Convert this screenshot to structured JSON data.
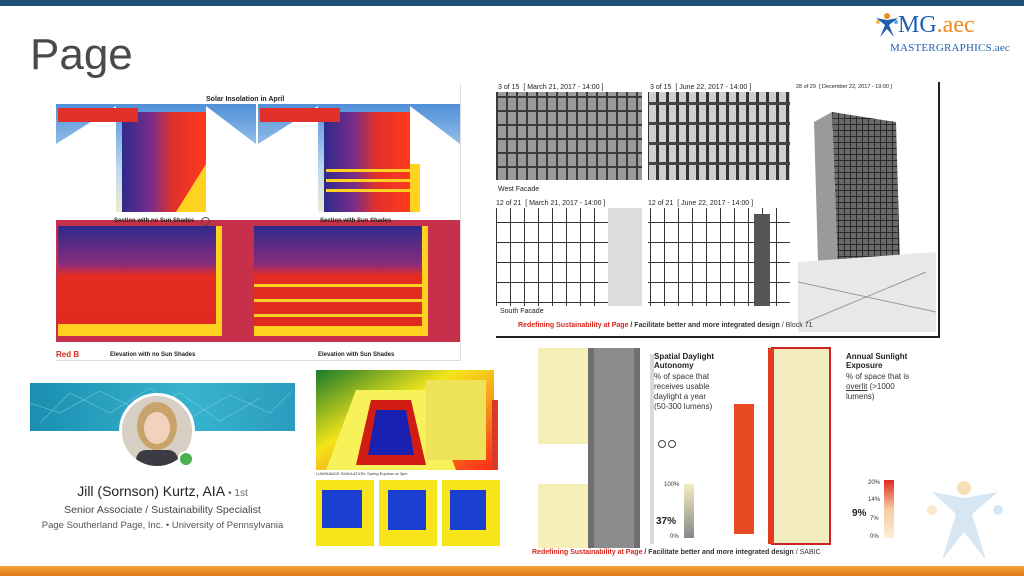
{
  "slide": {
    "title": "Page"
  },
  "logo": {
    "brand": "MG",
    "suffix": ".aec",
    "tagline": "MASTERGRAPHICS.aec"
  },
  "insolation": {
    "title": "Solar Insolation in April",
    "labels": [
      "Section with no Sun Shades",
      "Section with Sun Shades",
      "Elevation with no Sun Shades",
      "Elevation with Sun Shades"
    ],
    "corner_label": "Red B"
  },
  "daylight_studies": {
    "frames": [
      {
        "counter": "3 of 15",
        "date": "[ March 21, 2017 - 14:00 ]"
      },
      {
        "counter": "3 of 15",
        "date": "[ June 22, 2017 - 14:00 ]"
      },
      {
        "counter": "28 of 29",
        "date": "[ December 22, 2017 - 19:00 ]"
      },
      {
        "counter": "12 of 21",
        "date": "[ March 21, 2017 - 14:00 ]"
      },
      {
        "counter": "12 of 21",
        "date": "[ June 22, 2017 - 14:00 ]"
      }
    ],
    "west_label": "West Facade",
    "south_label": "South Facade",
    "footer_red": "Redefining Sustainability at Page",
    "footer_bold": " / Facilitate better and more integrated design",
    "footer_tail": " / Block 71"
  },
  "profile": {
    "name": "Jill (Sornson) Kurtz, AIA",
    "degree": "• 1st",
    "role": "Senior Associate / Sustainability Specialist",
    "org": "Page Southerland Page, Inc. • University of Pennsylvania"
  },
  "render": {
    "caption": "LUMINANCE SIMULATION: Spring Equinox at 3pm"
  },
  "metrics": {
    "sda_title": "Spatial Daylight Autonomy",
    "sda_desc": "% of space that receives usable daylight a year (50-300 lumens)",
    "sda_value": "37%",
    "sda_top": "100%",
    "sda_bottom": "0%",
    "ase_title": "Annual Sunlight Exposure",
    "ase_desc_1": "% of space that is ",
    "ase_desc_u": "overlit",
    "ase_desc_2": " (>1000 lumens)",
    "ase_value": "9%",
    "ase_ticks": [
      "20%",
      "14%",
      "7%",
      "0%"
    ],
    "footer_red": "Redefining Sustainability at Page",
    "footer_bold": " / Facilitate better and more integrated design",
    "footer_tail": " / SABIC"
  },
  "colors": {
    "accent_blue": "#1f4e79",
    "accent_orange": "#ef8a1e",
    "insolation_red": "#d92b22",
    "insolation_blue": "#2e2a8c",
    "insolation_yellow": "#ffd21f"
  }
}
